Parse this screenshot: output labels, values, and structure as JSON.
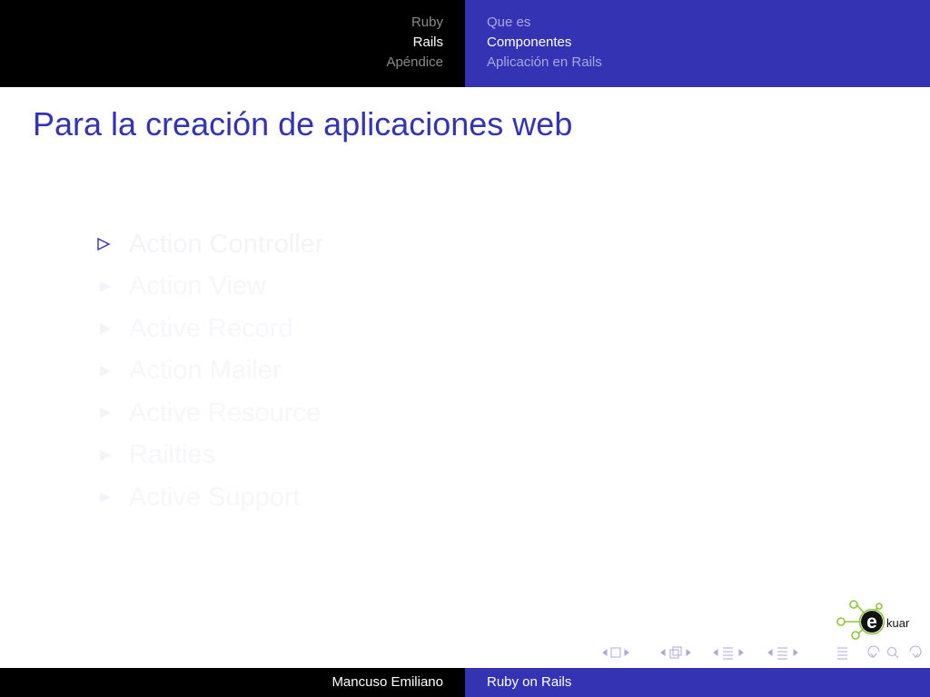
{
  "header": {
    "sections": [
      {
        "label": "Ruby",
        "active": false
      },
      {
        "label": "Rails",
        "active": true
      },
      {
        "label": "Apéndice",
        "active": false
      }
    ],
    "subsections": [
      {
        "label": "Que es",
        "active": false
      },
      {
        "label": "Componentes",
        "active": true
      },
      {
        "label": "Aplicación en Rails",
        "active": false
      }
    ]
  },
  "frame": {
    "title": "Para la creación de aplicaciones web",
    "items": [
      "Action Controller",
      "Action View",
      "Active Record",
      "Action Mailer",
      "Active Resource",
      "Railties",
      "Active Support"
    ]
  },
  "logo": {
    "text": "kuar",
    "letter": "e"
  },
  "footer": {
    "author": "Mancuso Emiliano",
    "talk_title": "Ruby on Rails"
  },
  "colors": {
    "theme_blue": "#3333b3",
    "header_black": "#000000",
    "logo_green": "#8cc63f"
  }
}
